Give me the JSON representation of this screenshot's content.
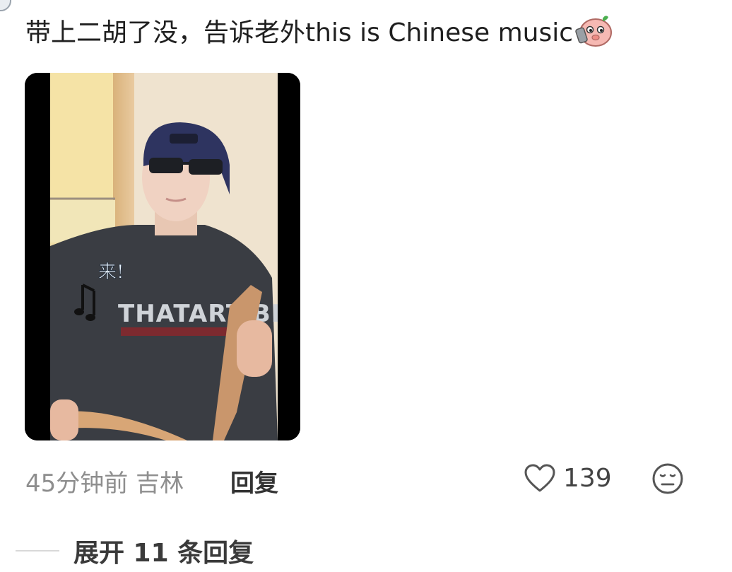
{
  "comment": {
    "text": "带上二胡了没，告诉老外this is Chinese music",
    "sticker": "pig-face-sticker"
  },
  "media": {
    "type": "video-thumbnail",
    "overlay_text": "来!",
    "overlay_icon": "music-notes-icon",
    "shirt_print": "THATART BLACKLAN"
  },
  "meta": {
    "time_location": "45分钟前 吉林",
    "reply_label": "回复",
    "like_icon": "heart-outline-icon",
    "like_count": "139",
    "reaction_icon": "neutral-face-icon"
  },
  "replies": {
    "expand_label": "展开 11 条回复"
  },
  "colors": {
    "primary_text": "#1f1f1f",
    "secondary_text": "#8e8e8e",
    "icon": "#555555"
  }
}
